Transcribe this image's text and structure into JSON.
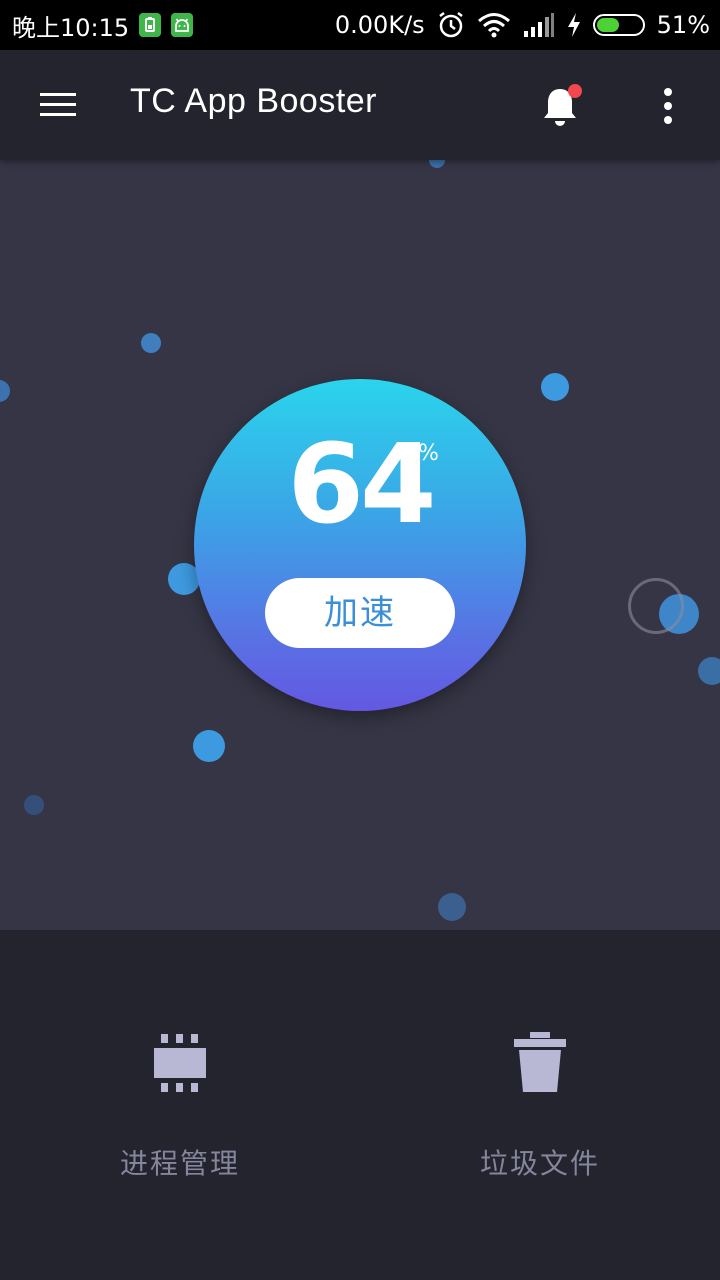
{
  "status_bar": {
    "time": "晚上10:15",
    "network_speed": "0.00K/s",
    "battery_percent": "51%",
    "battery_level": 0.51,
    "icons": [
      "battery-saver-icon",
      "android-icon",
      "alarm-icon",
      "wifi-icon",
      "signal-icon",
      "charging-icon",
      "battery-icon"
    ]
  },
  "app_bar": {
    "title": "TC App Booster",
    "icons": [
      "menu-icon",
      "bell-icon",
      "more-vert-icon"
    ],
    "notification_dot_color": "#f4474d"
  },
  "booster": {
    "memory_percent": "64",
    "percent_unit": "%",
    "boost_button_label": "加速",
    "gauge_gradient": [
      "#2bd4ec",
      "#6358e2"
    ]
  },
  "bottom_nav": {
    "items": [
      {
        "label": "进程管理",
        "icon": "memory-chip-icon"
      },
      {
        "label": "垃圾文件",
        "icon": "trash-icon"
      }
    ],
    "icon_color": "#b8b8d4",
    "label_color": "#85859c"
  },
  "colors": {
    "app_bar_bg": "#24242f",
    "main_bg": "#353545",
    "accent": "#3b8fd6"
  }
}
